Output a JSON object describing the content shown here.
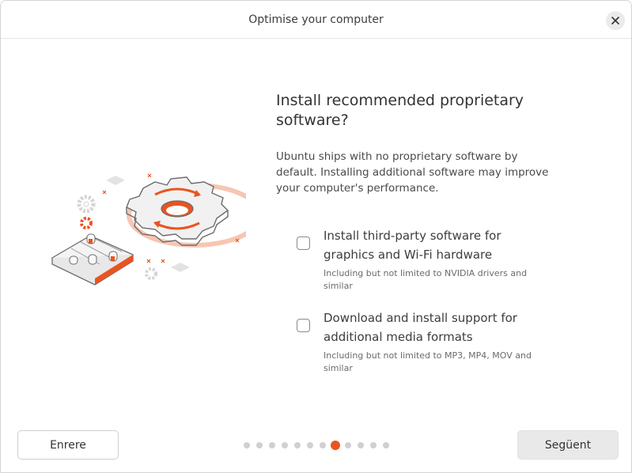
{
  "window": {
    "title": "Optimise your computer"
  },
  "main": {
    "heading": "Install recommended proprietary software?",
    "description": "Ubuntu ships with no proprietary software by default. Installing additional software may improve your computer's performance.",
    "options": [
      {
        "label": "Install third-party software for graphics and Wi-Fi hardware",
        "sublabel": "Including but not limited to NVIDIA drivers and similar",
        "checked": false
      },
      {
        "label": "Download and install support for additional media formats",
        "sublabel": "Including but not limited to MP3, MP4, MOV and similar",
        "checked": false
      }
    ]
  },
  "footer": {
    "back_label": "Enrere",
    "next_label": "Següent",
    "pager": {
      "total": 12,
      "current": 8
    }
  },
  "colors": {
    "accent": "#e95420",
    "accent_light": "#f7c6b3"
  },
  "icons": {
    "close": "close-icon",
    "illustration": "gears-settings-illustration"
  }
}
